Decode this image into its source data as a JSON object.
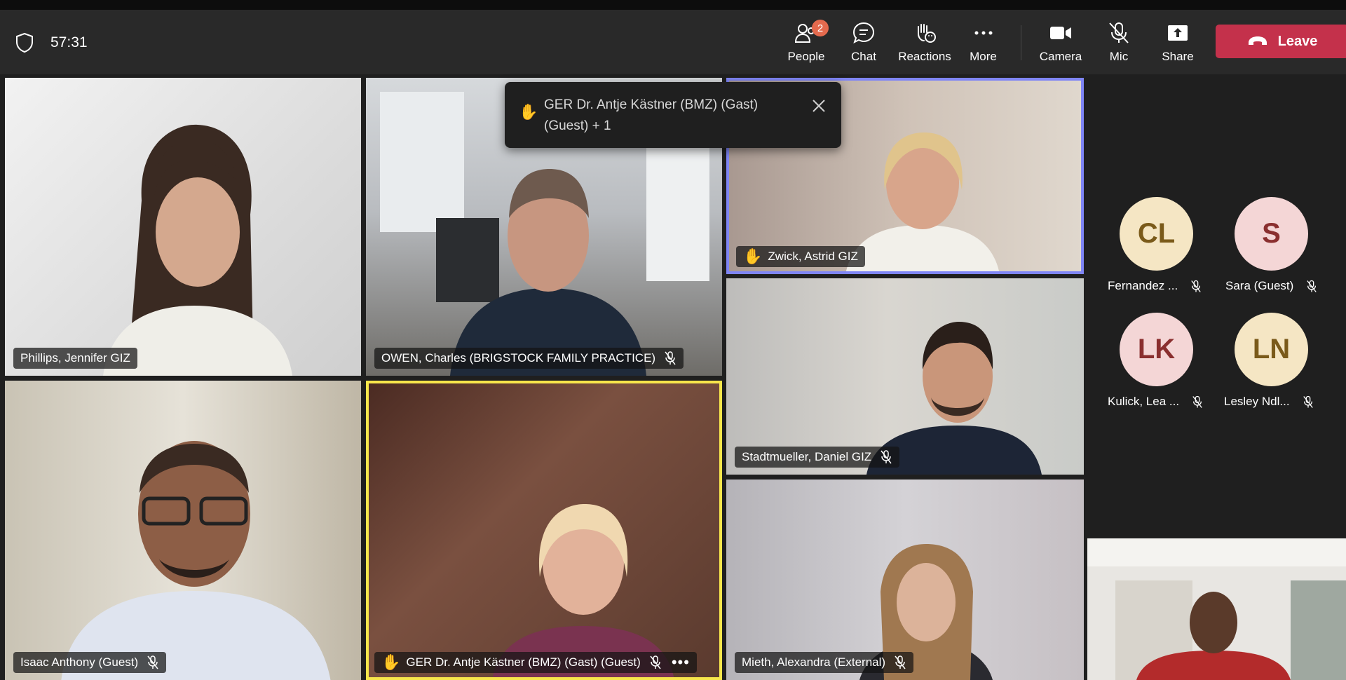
{
  "meeting": {
    "timer": "57:31"
  },
  "toolbar": {
    "people": {
      "label": "People",
      "badge": "2"
    },
    "chat": {
      "label": "Chat"
    },
    "reactions": {
      "label": "Reactions"
    },
    "more": {
      "label": "More"
    },
    "camera": {
      "label": "Camera"
    },
    "mic": {
      "label": "Mic"
    },
    "share": {
      "label": "Share"
    },
    "leave": {
      "label": "Leave"
    }
  },
  "toast": {
    "line1": "GER Dr. Antje Kästner (BMZ) (Gast)",
    "line2": "(Guest) + 1"
  },
  "tiles": [
    {
      "name": "Phillips, Jennifer GIZ"
    },
    {
      "name": "OWEN, Charles (BRIGSTOCK FAMILY PRACTICE)"
    },
    {
      "name": "Zwick, Astrid GIZ"
    },
    {
      "name": "Stadtmueller, Daniel GIZ"
    },
    {
      "name": "Isaac Anthony (Guest)"
    },
    {
      "name": "GER Dr. Antje Kästner (BMZ) (Gast) (Guest)"
    },
    {
      "name": "Mieth, Alexandra (External)"
    }
  ],
  "avatars": [
    {
      "initials": "CL",
      "name": "Fernandez ...",
      "bg": "#f5e6c4",
      "fg": "#7a5a1a"
    },
    {
      "initials": "S",
      "name": "Sara (Guest)",
      "bg": "#f4d6d6",
      "fg": "#8a2f2f"
    },
    {
      "initials": "LK",
      "name": "Kulick, Lea ...",
      "bg": "#f4d6d6",
      "fg": "#8a2f2f"
    },
    {
      "initials": "LN",
      "name": "Lesley Ndl...",
      "bg": "#f5e6c4",
      "fg": "#7a5a1a"
    }
  ],
  "colors": {
    "leave": "#c4314b",
    "speaking_frame": "#7f85f5",
    "raised_hand_frame": "#f7e64b",
    "badge": "#e46a4e"
  }
}
